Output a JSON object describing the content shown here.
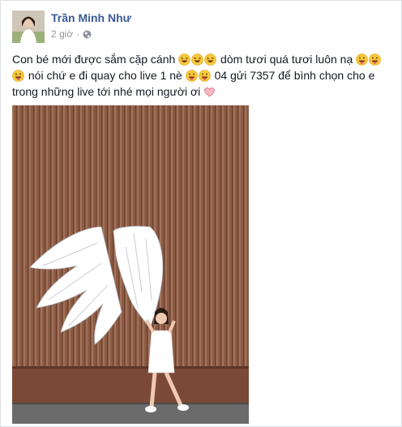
{
  "post": {
    "author": "Trần Minh Như",
    "time": "2 giờ",
    "separator": "·",
    "privacy_icon": "globe-icon",
    "text_parts": {
      "p1": "Con bé mới được sắm cặp cánh ",
      "p2": " dòm tươi quá tươi luôn nạ ",
      "p3": " nói chứ e đi quay cho live 1 nè ",
      "p4": " 04 gửi 7357 để bình chọn cho e trong những live tới nhé mọi người ơi "
    },
    "emoji": {
      "laugh": "grinning-squint-emoji",
      "tongue": "tongue-out-emoji",
      "heart": "heart-emoji"
    }
  },
  "colors": {
    "author_link": "#3b5998",
    "meta_text": "#90949c",
    "wall": "#8a5a43"
  }
}
